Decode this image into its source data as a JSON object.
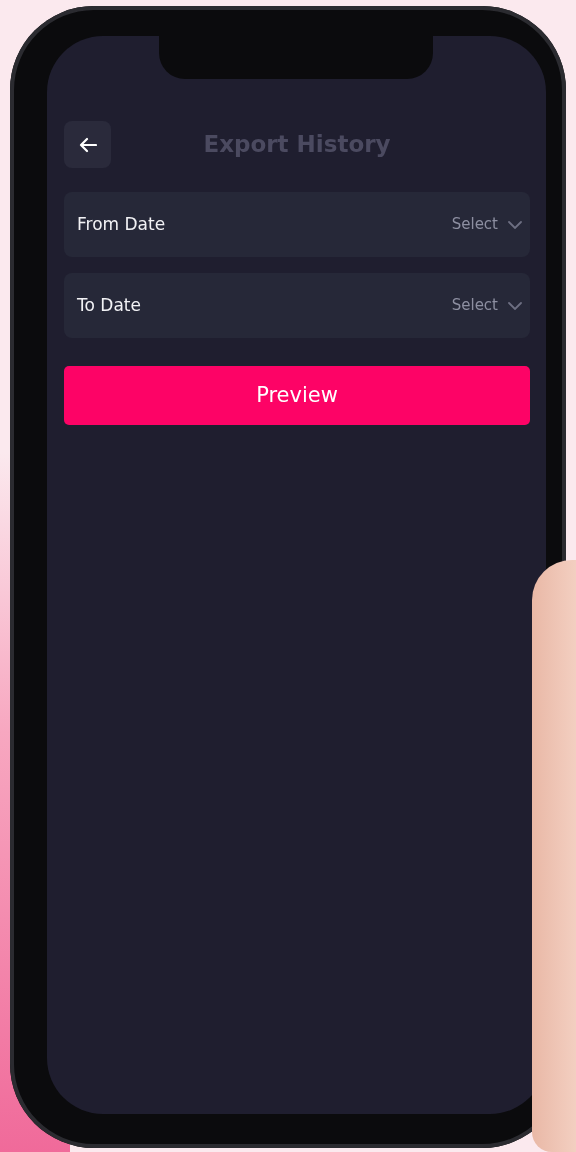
{
  "header": {
    "title": "Export History"
  },
  "fields": [
    {
      "label": "From Date",
      "placeholder": "Select"
    },
    {
      "label": "To Date",
      "placeholder": "Select"
    }
  ],
  "buttons": [
    {
      "label": "Preview"
    }
  ]
}
